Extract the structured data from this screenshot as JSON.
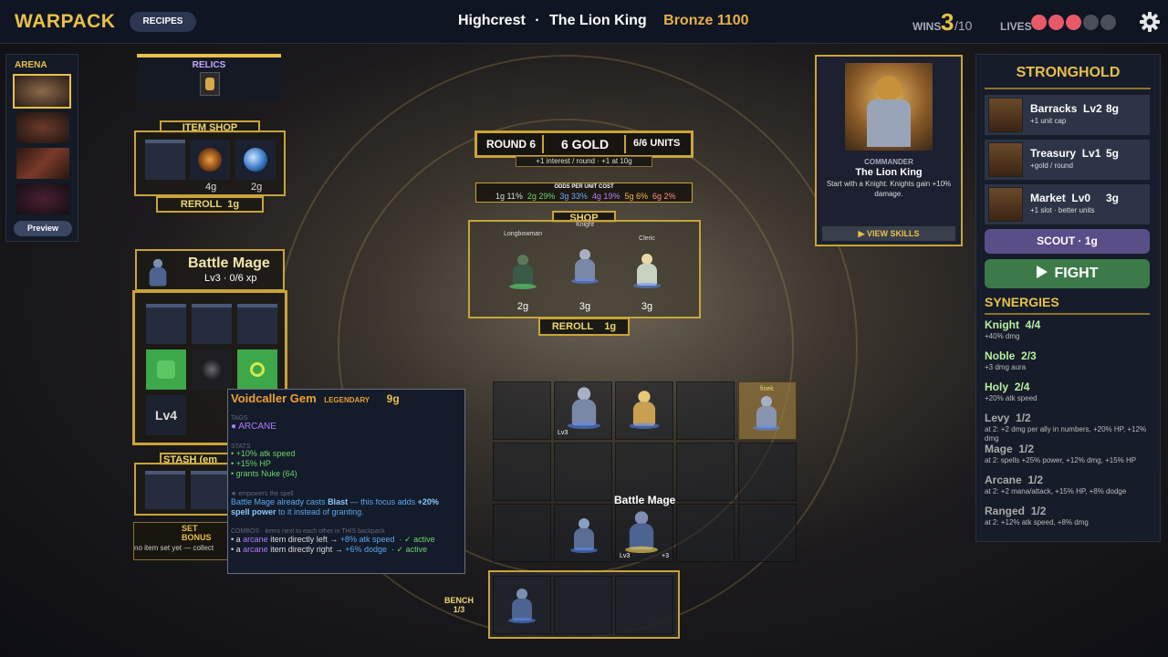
{
  "top": {
    "logo": "WARPACK",
    "recipes": "RECIPES",
    "city": "Highcrest",
    "commander": "The Lion King",
    "sep": "·",
    "rank": "Bronze 1100",
    "wins_label": "WINS",
    "wins": "3",
    "wins_max": "/10",
    "lives_label": "LIVES",
    "lives": [
      true,
      true,
      true,
      false,
      false
    ]
  },
  "arena": {
    "title": "ARENA",
    "preview": "Preview"
  },
  "relics": {
    "title": "RELICS"
  },
  "item_shop": {
    "title": "ITEM SHOP",
    "prices": [
      "4g",
      "2g"
    ],
    "reroll": "REROLL",
    "reroll_cost": "1g"
  },
  "round": {
    "round": "ROUND 6",
    "gold": "6 GOLD",
    "units": "6/6 UNITS",
    "interest": "+1 interest / round · +1 at 10g"
  },
  "odds": {
    "title": "ODDS PER UNIT COST",
    "values": [
      {
        "t": "1g 11%",
        "c": "#dddddd"
      },
      {
        "t": "2g 29%",
        "c": "#6dd36d"
      },
      {
        "t": "3g 33%",
        "c": "#6aa8ff"
      },
      {
        "t": "4g 19%",
        "c": "#c07bff"
      },
      {
        "t": "5g 6%",
        "c": "#ffb347"
      },
      {
        "t": "6g 2%",
        "c": "#ff8a8a"
      }
    ]
  },
  "shop": {
    "title": "SHOP",
    "units": [
      {
        "name": "Longbowman",
        "price": "2g"
      },
      {
        "name": "Knight",
        "price": "3g"
      },
      {
        "name": "Cleric",
        "price": "3g"
      }
    ],
    "reroll": "REROLL",
    "reroll_cost": "1g"
  },
  "commander_card": {
    "label": "COMMANDER",
    "name": "The Lion King",
    "desc": "Start with a Knight. Knights gain +10% damage.",
    "button": "▶ VIEW SKILLS"
  },
  "stronghold": {
    "title": "STRONGHOLD",
    "buildings": [
      {
        "name": "Barracks",
        "lv": "Lv2",
        "cost": "8g",
        "desc": "+1 unit cap"
      },
      {
        "name": "Treasury",
        "lv": "Lv1",
        "cost": "5g",
        "desc": "+gold / round"
      },
      {
        "name": "Market",
        "lv": "Lv0",
        "cost": "3g",
        "desc": "+1 slot · better units"
      }
    ],
    "scout": "SCOUT · 1g",
    "fight": "FIGHT"
  },
  "synergies": {
    "title": "SYNERGIES",
    "items": [
      {
        "name": "Knight",
        "count": "4/4",
        "desc": "+40% dmg",
        "active": true
      },
      {
        "name": "Noble",
        "count": "2/3",
        "desc": "+3 dmg aura",
        "active": true
      },
      {
        "name": "Holy",
        "count": "2/4",
        "desc": "+20% atk speed",
        "active": true
      },
      {
        "name": "Levy",
        "count": "1/2",
        "desc": "at 2: +2 dmg per ally in numbers, +20% HP, +12% dmg",
        "active": false
      },
      {
        "name": "Mage",
        "count": "1/2",
        "desc": "at 2: spells +25% power, +12% dmg, +15% HP",
        "active": false
      },
      {
        "name": "Arcane",
        "count": "1/2",
        "desc": "at 2: +2 mana/attack, +15% HP, +8% dodge",
        "active": false
      },
      {
        "name": "Ranged",
        "count": "1/2",
        "desc": "at 2: +12% atk speed, +8% dmg",
        "active": false
      }
    ]
  },
  "hero": {
    "name": "Battle Mage",
    "level": "Lv3 · 0/6 xp",
    "lv_slot": "Lv4"
  },
  "stash": {
    "title": "STASH (em",
    "set_bonus": "SET BONUS",
    "set_desc": "no item set yet — collect"
  },
  "tooltip": {
    "name": "Voidcaller Gem",
    "rarity": "LEGENDARY",
    "price": "9g",
    "tags_label": "TAGS",
    "tag": "● ARCANE",
    "stats_label": "STATS",
    "stats": [
      "• +10% atk speed",
      "• +15% HP",
      "• grants Nuke (64)"
    ],
    "spell_label": "★ empowers the spell",
    "spell_a": "Battle Mage already casts ",
    "spell_b": "Blast",
    "spell_c": " — this focus adds ",
    "spell_d": "+20% spell power",
    "spell_e": " to it instead of granting.",
    "combos_label": "COMBOS · items next to each other in THIS backpack",
    "combo1_a": "• a ",
    "combo1_b": "arcane",
    "combo1_c": " item directly left → ",
    "combo1_d": "+8% atk speed",
    "combo1_e": "· ✓ active",
    "combo2_a": "• a ",
    "combo2_b": "arcane",
    "combo2_c": " item directly right → ",
    "combo2_d": "+6% dodge",
    "combo2_e": "· ✓ active"
  },
  "board": {
    "unit_label": "Battle Mage",
    "lv3a": "Lv3",
    "lv3b": "Lv3",
    "plus3": "+3",
    "finek": "finek",
    "bench": "BENCH",
    "bench_count": "1/3"
  }
}
